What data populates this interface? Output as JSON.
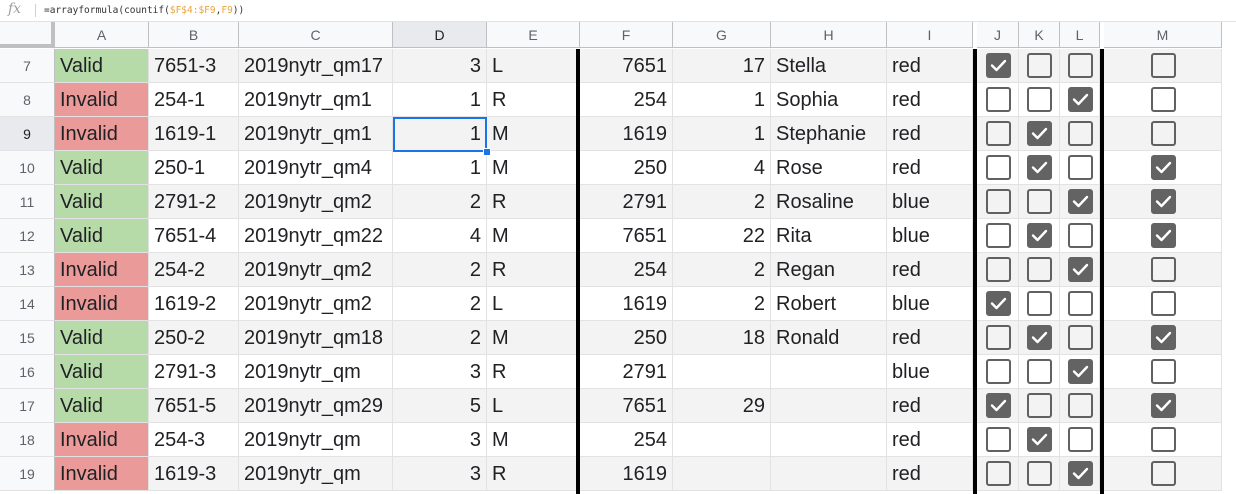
{
  "formula_bar": {
    "icon": "fx-icon",
    "text_prefix": "=arrayformula(countif(",
    "text_ref1": "$F$4:$F9",
    "text_comma": ",",
    "text_ref2": "F9",
    "text_suffix": "))"
  },
  "columns": [
    "A",
    "B",
    "C",
    "D",
    "E",
    "F",
    "G",
    "H",
    "I",
    "J",
    "K",
    "L",
    "M"
  ],
  "selected_column": "D",
  "selected_row": "9",
  "active_cell": "D9",
  "status_colors": {
    "valid": "#b7dba8",
    "invalid": "#ea9a98"
  },
  "rows": [
    {
      "num": "7",
      "a": "Valid",
      "b": "7651-3",
      "c": "2019nytr_qm17",
      "d": "3",
      "e": "L",
      "f": "7651",
      "g": "17",
      "h": "Stella",
      "i": "red",
      "j": true,
      "k": false,
      "l": false,
      "m": false
    },
    {
      "num": "8",
      "a": "Invalid",
      "b": "254-1",
      "c": "2019nytr_qm1",
      "d": "1",
      "e": "R",
      "f": "254",
      "g": "1",
      "h": "Sophia",
      "i": "red",
      "j": false,
      "k": false,
      "l": true,
      "m": false
    },
    {
      "num": "9",
      "a": "Invalid",
      "b": "1619-1",
      "c": "2019nytr_qm1",
      "d": "1",
      "e": "M",
      "f": "1619",
      "g": "1",
      "h": "Stephanie",
      "i": "red",
      "j": false,
      "k": true,
      "l": false,
      "m": false
    },
    {
      "num": "10",
      "a": "Valid",
      "b": "250-1",
      "c": "2019nytr_qm4",
      "d": "1",
      "e": "M",
      "f": "250",
      "g": "4",
      "h": "Rose",
      "i": "red",
      "j": false,
      "k": true,
      "l": false,
      "m": true
    },
    {
      "num": "11",
      "a": "Valid",
      "b": "2791-2",
      "c": "2019nytr_qm2",
      "d": "2",
      "e": "R",
      "f": "2791",
      "g": "2",
      "h": "Rosaline",
      "i": "blue",
      "j": false,
      "k": false,
      "l": true,
      "m": true
    },
    {
      "num": "12",
      "a": "Valid",
      "b": "7651-4",
      "c": "2019nytr_qm22",
      "d": "4",
      "e": "M",
      "f": "7651",
      "g": "22",
      "h": "Rita",
      "i": "blue",
      "j": false,
      "k": true,
      "l": false,
      "m": true
    },
    {
      "num": "13",
      "a": "Invalid",
      "b": "254-2",
      "c": "2019nytr_qm2",
      "d": "2",
      "e": "R",
      "f": "254",
      "g": "2",
      "h": "Regan",
      "i": "red",
      "j": false,
      "k": false,
      "l": true,
      "m": false
    },
    {
      "num": "14",
      "a": "Invalid",
      "b": "1619-2",
      "c": "2019nytr_qm2",
      "d": "2",
      "e": "L",
      "f": "1619",
      "g": "2",
      "h": "Robert",
      "i": "blue",
      "j": true,
      "k": false,
      "l": false,
      "m": false
    },
    {
      "num": "15",
      "a": "Valid",
      "b": "250-2",
      "c": "2019nytr_qm18",
      "d": "2",
      "e": "M",
      "f": "250",
      "g": "18",
      "h": "Ronald",
      "i": "red",
      "j": false,
      "k": true,
      "l": false,
      "m": true
    },
    {
      "num": "16",
      "a": "Valid",
      "b": "2791-3",
      "c": "2019nytr_qm",
      "d": "3",
      "e": "R",
      "f": "2791",
      "g": "",
      "h": "",
      "i": "blue",
      "j": false,
      "k": false,
      "l": true,
      "m": false
    },
    {
      "num": "17",
      "a": "Valid",
      "b": "7651-5",
      "c": "2019nytr_qm29",
      "d": "5",
      "e": "L",
      "f": "7651",
      "g": "29",
      "h": "",
      "i": "red",
      "j": true,
      "k": false,
      "l": false,
      "m": true
    },
    {
      "num": "18",
      "a": "Invalid",
      "b": "254-3",
      "c": "2019nytr_qm",
      "d": "3",
      "e": "M",
      "f": "254",
      "g": "",
      "h": "",
      "i": "red",
      "j": false,
      "k": true,
      "l": false,
      "m": false
    },
    {
      "num": "19",
      "a": "Invalid",
      "b": "1619-3",
      "c": "2019nytr_qm",
      "d": "3",
      "e": "R",
      "f": "1619",
      "g": "",
      "h": "",
      "i": "red",
      "j": false,
      "k": false,
      "l": true,
      "m": false
    }
  ]
}
